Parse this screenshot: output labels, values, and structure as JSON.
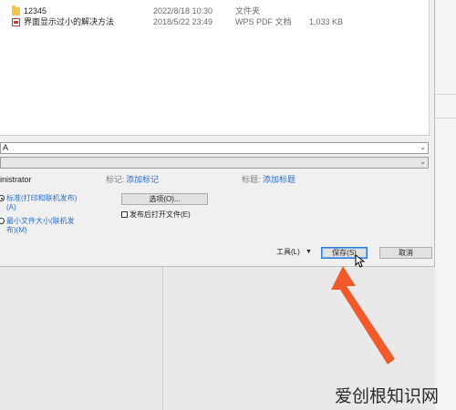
{
  "files": [
    {
      "name": "12345",
      "date": "2022/8/18 10:30",
      "type": "文件夹",
      "size": "",
      "icon": "folder-icon"
    },
    {
      "name": "界面显示过小的解决方法",
      "date": "2018/5/22 23:49",
      "type": "WPS PDF 文档",
      "size": "1,033 KB",
      "icon": "pdf-file-icon"
    }
  ],
  "filename_field": {
    "value": "A"
  },
  "filetype_field": {
    "value": ""
  },
  "meta": {
    "author_value": "inistrator",
    "tags_label": "标记:",
    "tags_placeholder": "添加标记",
    "title_label": "标题:",
    "title_placeholder": "添加标题"
  },
  "options": {
    "radio_standard": "标准(打印和联机发布)(A)",
    "radio_standard_line1": "标准(打印和联机发布)",
    "radio_standard_line2": "(A)",
    "radio_minimum_line1": "最小文件大小(联机发",
    "radio_minimum_line2": "布)(M)",
    "options_button": "选项(O)...",
    "open_after_publish": "发布后打开文件(E)"
  },
  "footer": {
    "tools_label": "工具(L)",
    "tools_arrow": "▼",
    "save_label": "保存(S)",
    "cancel_label": "取消"
  },
  "watermark": "爱创根知识网",
  "colors": {
    "accent": "#2f6fc0",
    "arrow": "#f15a2b",
    "folder": "#f3c44a",
    "pdf": "#c8382c"
  }
}
